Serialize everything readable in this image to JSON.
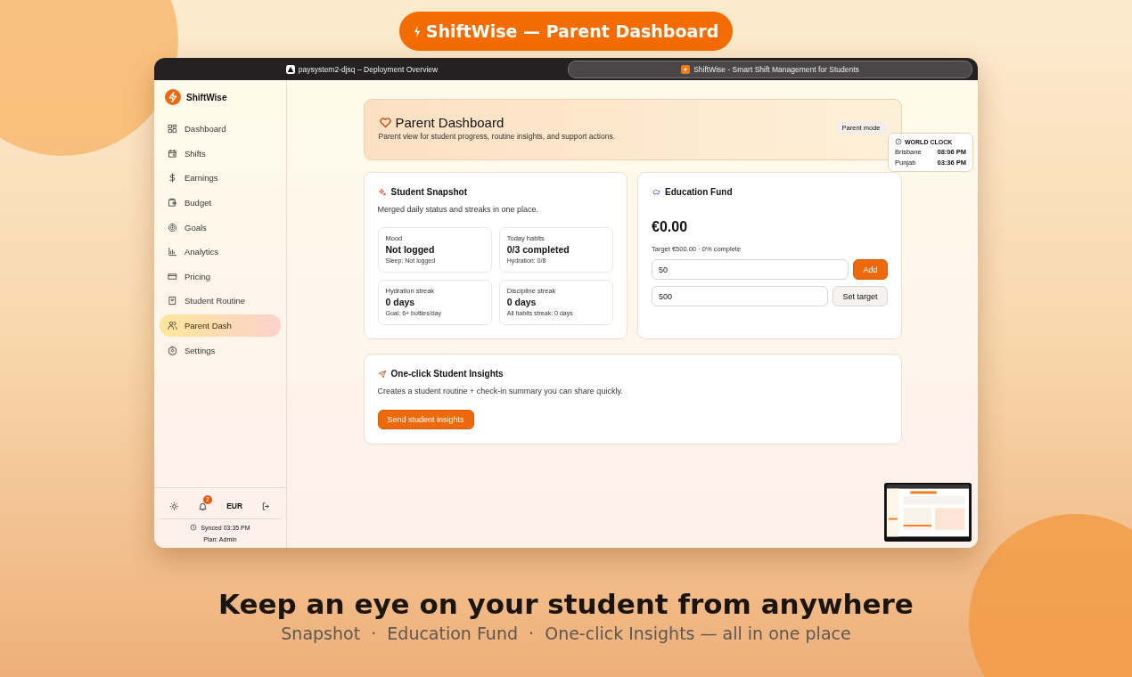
{
  "banner": {
    "title": "ShiftWise — Parent Dashboard"
  },
  "browser": {
    "tabs": [
      {
        "title": "paysystem2-djsq – Deployment Overview",
        "selected": false
      },
      {
        "title": "ShiftWise - Smart Shift Management for Students",
        "selected": true
      }
    ]
  },
  "sidebar": {
    "brand": "ShiftWise",
    "items": [
      {
        "label": "Dashboard",
        "selected": false
      },
      {
        "label": "Shifts",
        "selected": false
      },
      {
        "label": "Earnings",
        "selected": false
      },
      {
        "label": "Budget",
        "selected": false
      },
      {
        "label": "Goals",
        "selected": false
      },
      {
        "label": "Analytics",
        "selected": false
      },
      {
        "label": "Pricing",
        "selected": false
      },
      {
        "label": "Student Routine",
        "selected": false
      },
      {
        "label": "Parent Dash",
        "selected": true
      },
      {
        "label": "Settings",
        "selected": false
      }
    ],
    "footer": {
      "notifications": "2",
      "currency": "EUR",
      "synced": "Synced 03:35 PM",
      "plan": "Plan: Admin"
    }
  },
  "header": {
    "title": "Parent Dashboard",
    "subtitle": "Parent view for student progress, routine insights, and support actions.",
    "badge": "Parent mode"
  },
  "world_clock": {
    "title": "WORLD CLOCK",
    "zones": [
      {
        "city": "Brisbane",
        "time": "08:06 PM"
      },
      {
        "city": "Punjab",
        "time": "03:36 PM"
      }
    ]
  },
  "snapshot": {
    "title": "Student Snapshot",
    "subtitle": "Merged daily status and streaks in one place.",
    "stats": [
      {
        "label": "Mood",
        "value": "Not logged",
        "note": "Sleep: Not logged"
      },
      {
        "label": "Today habits",
        "value": "0/3 completed",
        "note": "Hydration: 0/8"
      },
      {
        "label": "Hydration streak",
        "value": "0 days",
        "note": "Goal: 6+ bottles/day"
      },
      {
        "label": "Discipline streak",
        "value": "0 days",
        "note": "All habits streak: 0 days"
      }
    ]
  },
  "fund": {
    "title": "Education Fund",
    "amount": "€0.00",
    "progress": "Target €500.00 · 0% complete",
    "rows": [
      {
        "value": "50",
        "button": "Add",
        "kind": "primary"
      },
      {
        "value": "500",
        "button": "Set target",
        "kind": "secondary"
      }
    ]
  },
  "insights": {
    "title": "One-click Student Insights",
    "subtitle": "Creates a student routine + check-in summary you can share quickly.",
    "button": "Send student insights"
  },
  "tagline": {
    "title": "Keep an eye on your student from anywhere",
    "subtitle": "Snapshot  ·  Education Fund  ·  One-click Insights — all in one place"
  }
}
